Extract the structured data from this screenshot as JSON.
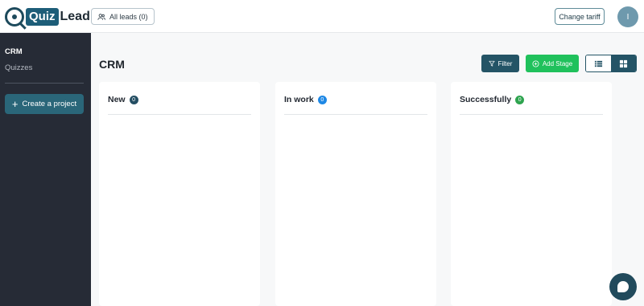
{
  "header": {
    "logo_text_1": "Quiz",
    "logo_text_2": "Lead",
    "all_leads_label": "All leads (0)",
    "change_tariff_label": "Change tariff",
    "avatar_initial": "I"
  },
  "sidebar": {
    "items": [
      {
        "label": "CRM",
        "active": true
      },
      {
        "label": "Quizzes",
        "active": false
      }
    ],
    "create_project_label": "Create a project"
  },
  "main": {
    "title": "CRM",
    "filter_label": "Filter",
    "add_stage_label": "Add Stage",
    "view_mode": "board",
    "columns": [
      {
        "title": "New",
        "count": "0",
        "badge_color": "#244e63"
      },
      {
        "title": "In work",
        "count": "0",
        "badge_color": "#1e88e5"
      },
      {
        "title": "Successfully",
        "count": "0",
        "badge_color": "#2ea44f"
      }
    ]
  },
  "colors": {
    "sidebar_bg": "#262b36",
    "primary": "#245466",
    "success": "#20c15c"
  }
}
